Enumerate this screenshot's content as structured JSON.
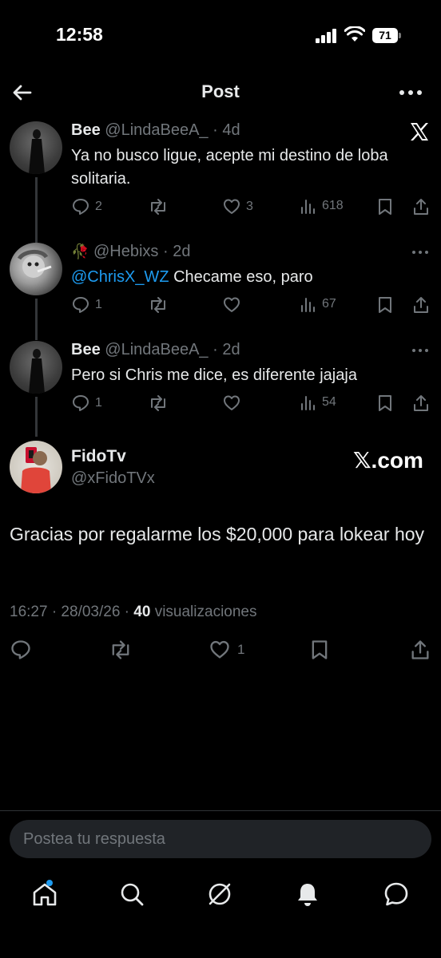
{
  "status": {
    "time": "12:58",
    "battery": "71"
  },
  "header": {
    "title": "Post"
  },
  "thread": [
    {
      "name": "Bee",
      "handle": "@LindaBeeA_",
      "time": "· 4d",
      "text": "Ya no busco ligue, acepte mi destino de loba solitaria.",
      "replies": "2",
      "reposts": "",
      "likes": "3",
      "views": "618"
    },
    {
      "name": "",
      "handle": "@Hebixs",
      "time": "· 2d",
      "mention": "@ChrisX_WZ",
      "text": " Checame eso, paro",
      "replies": "1",
      "reposts": "",
      "likes": "",
      "views": "67"
    },
    {
      "name": "Bee",
      "handle": "@LindaBeeA_",
      "time": "· 2d",
      "text": "Pero si Chris me dice, es diferente jajaja",
      "replies": "1",
      "reposts": "",
      "likes": "",
      "views": "54"
    }
  ],
  "main": {
    "name": "FidoTv",
    "handle": "@xFidoTVx",
    "brand": "𝕏.com",
    "text": "Gracias por regalarme los $20,000 para lokear hoy",
    "timestamp": "16:27 · 28/03/26 · ",
    "views_count": "40",
    "views_label": " visualizaciones",
    "likes": "1"
  },
  "reply": {
    "placeholder": "Postea tu respuesta"
  },
  "colors": {
    "accent": "#1d9bf0",
    "muted": "#71767b",
    "background": "#000000"
  }
}
